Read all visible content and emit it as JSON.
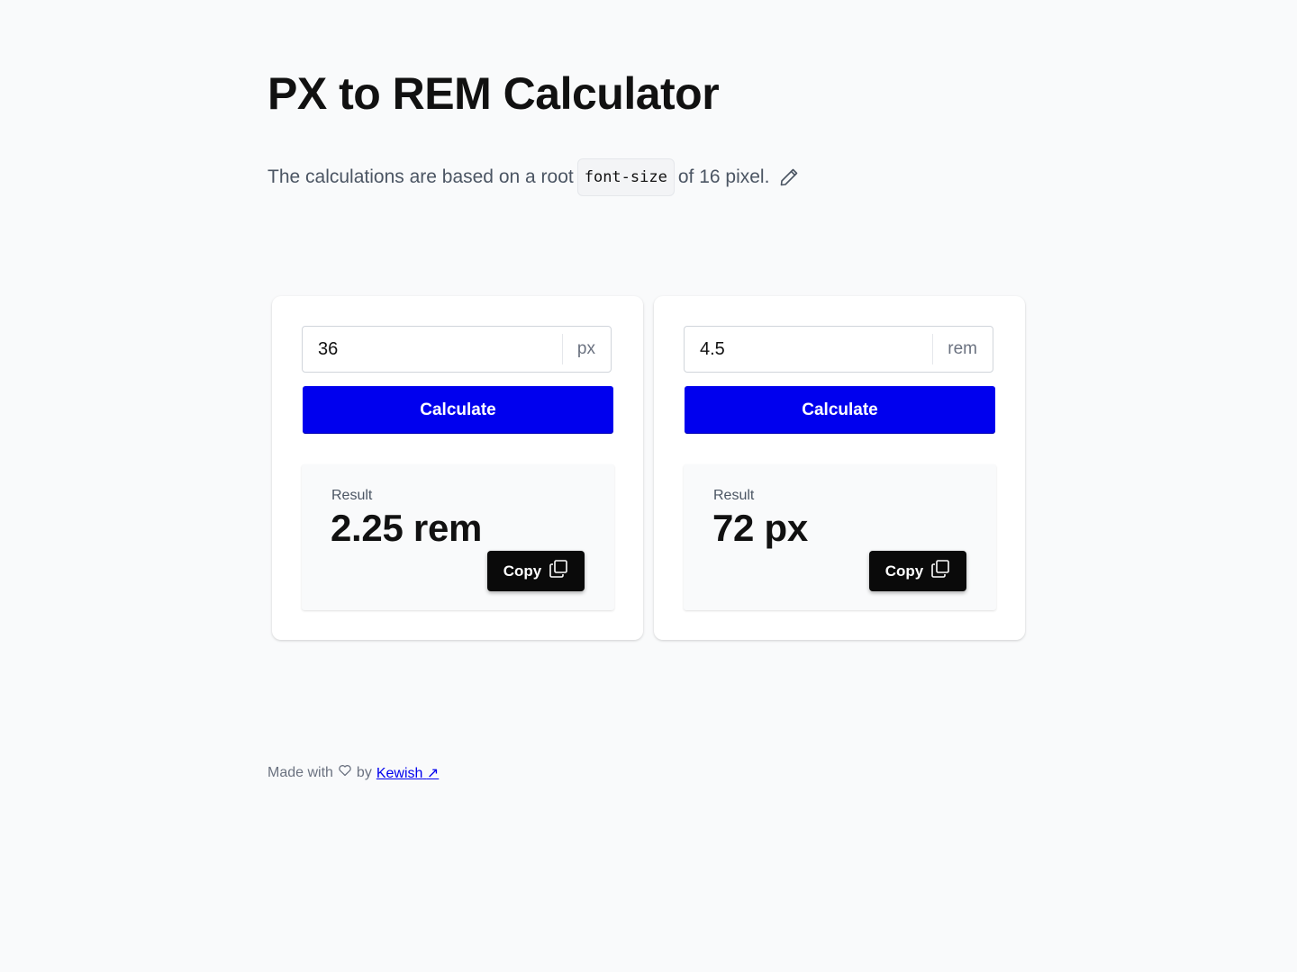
{
  "header": {
    "title": "PX to REM Calculator",
    "subtitle_before": "The calculations are based on a root",
    "subtitle_code": "font-size",
    "subtitle_after": "of 16 pixel.",
    "edit_icon": "pencil-icon"
  },
  "px_to_rem": {
    "input_value": "36",
    "unit": "px",
    "button_label": "Calculate",
    "result_label": "Result",
    "result_value": "2.25 rem",
    "copy_label": "Copy",
    "copy_icon": "copy-icon"
  },
  "rem_to_px": {
    "input_value": "4.5",
    "unit": "rem",
    "button_label": "Calculate",
    "result_label": "Result",
    "result_value": "72 px",
    "copy_label": "Copy",
    "copy_icon": "copy-icon"
  },
  "footer": {
    "made_with": "Made with",
    "heart_icon": "heart-icon",
    "by": "by",
    "author_link": "Kewish",
    "link_icon": "arrow-up-right-icon"
  },
  "colors": {
    "background": "#f9fafb",
    "primary_button": "#0000ee",
    "copy_button": "#0a0a0a",
    "link": "#0000ee"
  }
}
